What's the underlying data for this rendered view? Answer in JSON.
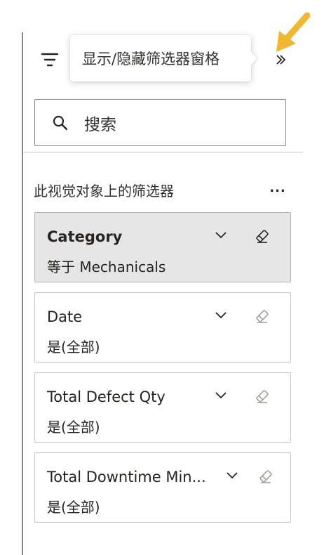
{
  "header": {
    "filter_icon": "filter-lines-icon",
    "collapse_icon": "double-chevron-right-icon",
    "arrow_color": "#f2b730"
  },
  "tooltip": {
    "text": "显示/隐藏筛选器窗格"
  },
  "search": {
    "placeholder": "搜索",
    "icon": "search-icon"
  },
  "section": {
    "label": "此视觉对象上的筛选器",
    "more": "..."
  },
  "filters": [
    {
      "title": "Category",
      "condition": "等于 Mechanicals",
      "active": true
    },
    {
      "title": "Date",
      "condition": "是(全部)",
      "active": false
    },
    {
      "title": "Total Defect Qty",
      "condition": "是(全部)",
      "active": false
    },
    {
      "title": "Total Downtime Min...",
      "condition": "是(全部)",
      "active": false
    }
  ],
  "colors": {
    "active_card_bg": "#e6e6e6",
    "border": "#c8c6c4",
    "text": "#252423"
  }
}
